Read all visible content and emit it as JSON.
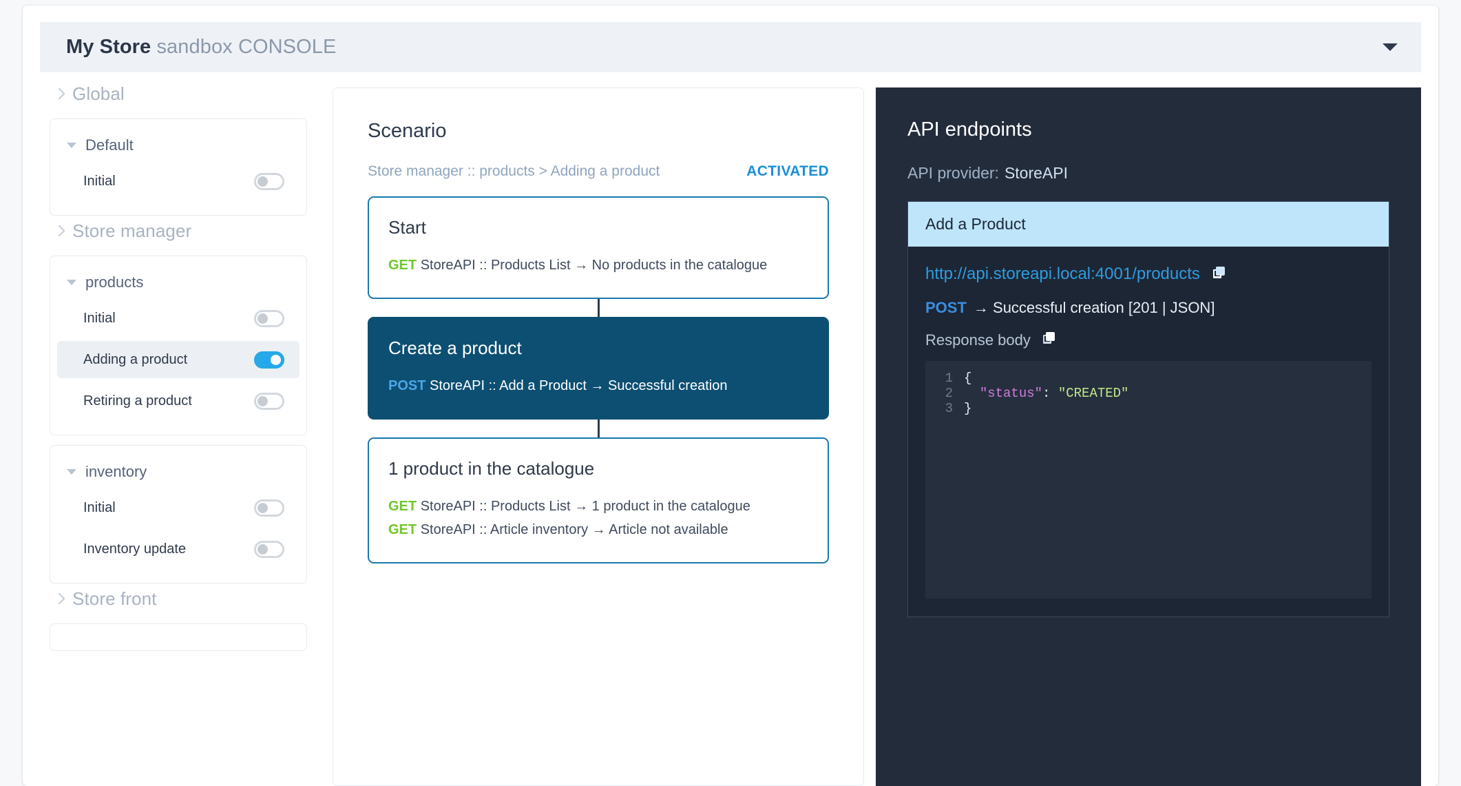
{
  "header": {
    "brand": "My Store",
    "suffix": " sandbox CONSOLE",
    "caret_icon": "chevron-down-icon"
  },
  "sidebar": {
    "sections": [
      {
        "label": "Global",
        "expanded": false,
        "groups": [
          {
            "name": "Default",
            "scenarios": [
              {
                "label": "Initial",
                "active": false,
                "selected": false
              }
            ]
          }
        ]
      },
      {
        "label": "Store manager",
        "expanded": false,
        "groups": [
          {
            "name": "products",
            "scenarios": [
              {
                "label": "Initial",
                "active": false,
                "selected": false
              },
              {
                "label": "Adding a product",
                "active": true,
                "selected": true
              },
              {
                "label": "Retiring a product",
                "active": false,
                "selected": false
              }
            ]
          },
          {
            "name": "inventory",
            "scenarios": [
              {
                "label": "Initial",
                "active": false,
                "selected": false
              },
              {
                "label": "Inventory update",
                "active": false,
                "selected": false
              }
            ]
          }
        ]
      },
      {
        "label": "Store front",
        "expanded": false,
        "groups": []
      }
    ]
  },
  "scenario": {
    "title": "Scenario",
    "breadcrumb": "Store manager :: products > Adding a product",
    "status": "ACTIVATED",
    "steps": [
      {
        "title": "Start",
        "active": false,
        "lines": [
          {
            "verb": "GET",
            "verb_class": "get",
            "text": "StoreAPI :: Products List → No products in the catalogue"
          }
        ]
      },
      {
        "title": "Create a product",
        "active": true,
        "lines": [
          {
            "verb": "POST",
            "verb_class": "post",
            "text": "StoreAPI :: Add a Product → Successful creation"
          }
        ]
      },
      {
        "title": "1 product in the catalogue",
        "active": false,
        "lines": [
          {
            "verb": "GET",
            "verb_class": "get",
            "text": "StoreAPI :: Products List → 1 product in the catalogue"
          },
          {
            "verb": "GET",
            "verb_class": "get",
            "text": "StoreAPI :: Article inventory → Article not available"
          }
        ]
      }
    ]
  },
  "api": {
    "title": "API endpoints",
    "provider_label": "API provider:",
    "provider_value": "StoreAPI",
    "endpoint": {
      "name": "Add a Product",
      "url": "http://api.storeapi.local:4001/products",
      "url_copy_icon": "copy-icon",
      "method": "POST",
      "method_result": "→ Successful creation [201 | JSON]",
      "response_label": "Response body",
      "response_copy_icon": "copy-icon",
      "code_lines": [
        {
          "n": "1",
          "punct_before": "{",
          "key": "",
          "colon": "",
          "str": ""
        },
        {
          "n": "2",
          "punct_before": "  ",
          "key": "\"status\"",
          "colon": ": ",
          "str": "\"CREATED\""
        },
        {
          "n": "3",
          "punct_before": "}",
          "key": "",
          "colon": "",
          "str": ""
        }
      ]
    }
  },
  "colors": {
    "accent_blue": "#26a9e8",
    "activated": "#1b8fd6",
    "get_green": "#6fc72b",
    "post_blue": "#4aa7e8",
    "active_card": "#0d4f72",
    "api_panel_bg": "#232c3b",
    "endpoint_head": "#bfe5fb"
  }
}
